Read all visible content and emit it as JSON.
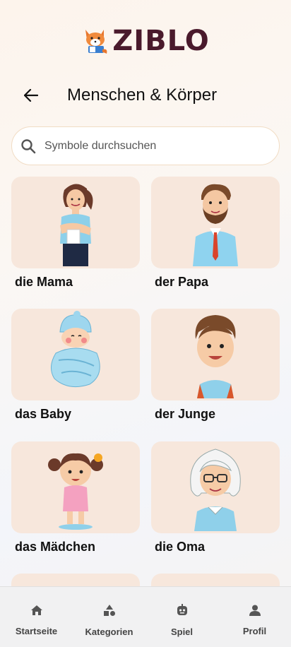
{
  "app": {
    "logo_text": "ZIBLO"
  },
  "header": {
    "title": "Menschen & Körper"
  },
  "search": {
    "placeholder": "Symbole durchsuchen",
    "value": ""
  },
  "cards": [
    {
      "label": "die Mama",
      "icon": "mother-icon"
    },
    {
      "label": "der Papa",
      "icon": "father-icon"
    },
    {
      "label": "das Baby",
      "icon": "baby-icon"
    },
    {
      "label": "der Junge",
      "icon": "boy-icon"
    },
    {
      "label": "das Mädchen",
      "icon": "girl-icon"
    },
    {
      "label": "die Oma",
      "icon": "grandmother-icon"
    }
  ],
  "bottom_nav": [
    {
      "label": "Startseite",
      "icon": "home-icon"
    },
    {
      "label": "Kategorien",
      "icon": "shapes-icon"
    },
    {
      "label": "Spiel",
      "icon": "robot-icon"
    },
    {
      "label": "Profil",
      "icon": "person-icon"
    }
  ],
  "colors": {
    "brand": "#4a1a2c",
    "tile": "#f7e7dc",
    "accent": "#f1dcc4"
  }
}
